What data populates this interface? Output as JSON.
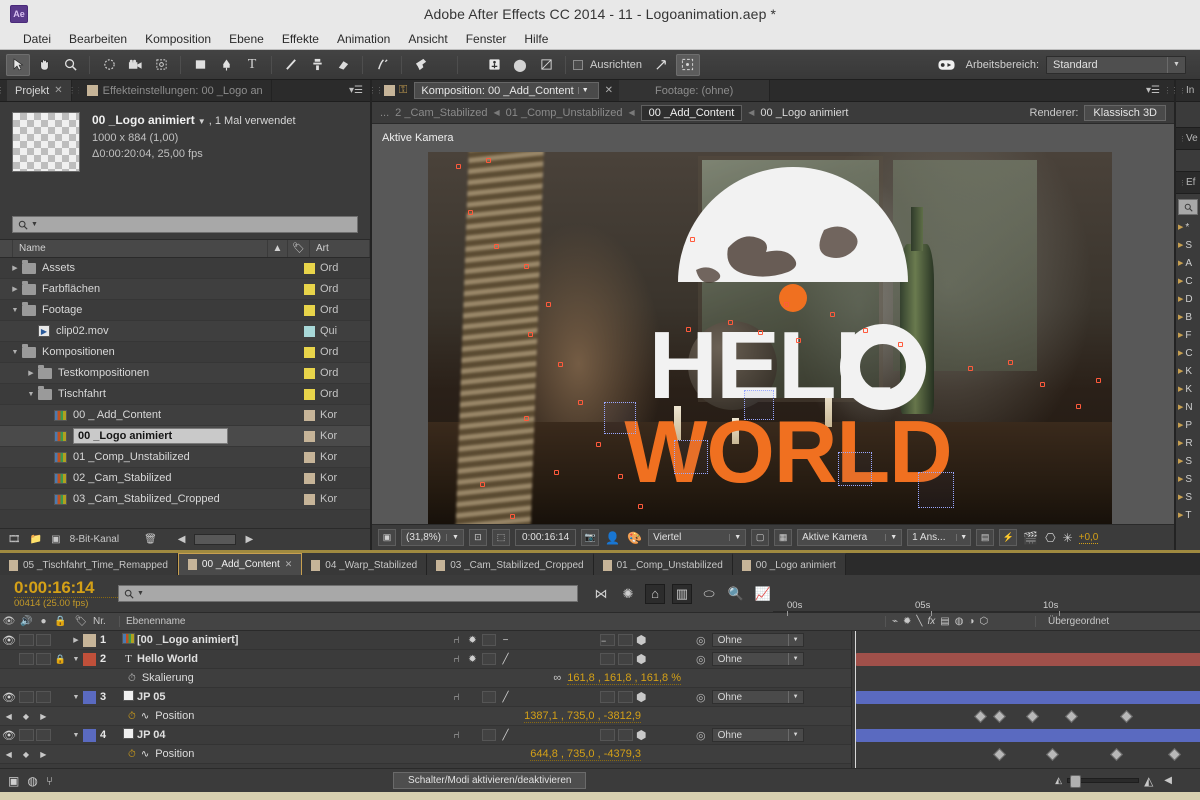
{
  "titlebar": {
    "logo": "Ae",
    "title": "Adobe After Effects CC 2014 - 11 - Logoanimation.aep *"
  },
  "menubar": {
    "items": [
      "Datei",
      "Bearbeiten",
      "Komposition",
      "Ebene",
      "Effekte",
      "Animation",
      "Ansicht",
      "Fenster",
      "Hilfe"
    ]
  },
  "toolbar": {
    "tools": [
      {
        "name": "selection-tool",
        "glyph": "➤"
      },
      {
        "name": "hand-tool",
        "glyph": "✋"
      },
      {
        "name": "zoom-tool",
        "glyph": "🔍"
      },
      {
        "name": "rotation-tool",
        "glyph": "↻"
      },
      {
        "name": "camera-tool",
        "glyph": "🎥"
      },
      {
        "name": "pan-behind-tool",
        "glyph": "✥"
      },
      {
        "name": "shape-tool",
        "glyph": "▢"
      },
      {
        "name": "pen-tool",
        "glyph": "✒"
      },
      {
        "name": "type-tool",
        "glyph": "T"
      },
      {
        "name": "brush-tool",
        "glyph": "/"
      },
      {
        "name": "clone-stamp-tool",
        "glyph": "♟"
      },
      {
        "name": "eraser-tool",
        "glyph": "▱"
      },
      {
        "name": "roto-brush-tool",
        "glyph": "⑂"
      },
      {
        "name": "puppet-pin-tool",
        "glyph": "📌"
      },
      {
        "name": "anchor-tool",
        "glyph": "⚓"
      },
      {
        "name": "mask-tool",
        "glyph": "●"
      },
      {
        "name": "snapping-tool",
        "glyph": "⌗"
      }
    ],
    "align_label": "Ausrichten",
    "workspace_label": "Arbeitsbereich:",
    "workspace_value": "Standard"
  },
  "project_panel": {
    "tabs": [
      {
        "label": "Projekt",
        "active": true,
        "closable": true
      },
      {
        "label": "Effekteinstellungen: 00 _Logo an",
        "active": false,
        "closable": false
      }
    ],
    "selected_item": {
      "name": "00 _Logo animiert",
      "usage": ", 1 Mal verwendet",
      "dimensions": "1000 x 884 (1,00)",
      "duration": "Δ0:00:20:04, 25,00 fps"
    },
    "search_placeholder": "",
    "columns": [
      "Name",
      "Art"
    ],
    "tree": [
      {
        "label": "Assets",
        "type": "folder",
        "indent": 0,
        "twirl": "▶",
        "color": "#e8d44a",
        "art": "Ord"
      },
      {
        "label": "Farbflächen",
        "type": "folder",
        "indent": 0,
        "twirl": "▶",
        "color": "#e8d44a",
        "art": "Ord"
      },
      {
        "label": "Footage",
        "type": "folder",
        "indent": 0,
        "twirl": "▼",
        "color": "#e8d44a",
        "art": "Ord"
      },
      {
        "label": "clip02.mov",
        "type": "movie",
        "indent": 1,
        "twirl": "",
        "color": "#a8d8d8",
        "art": "Qui"
      },
      {
        "label": "Kompositionen",
        "type": "folder",
        "indent": 0,
        "twirl": "▼",
        "color": "#e8d44a",
        "art": "Ord"
      },
      {
        "label": "Testkompositionen",
        "type": "folder",
        "indent": 1,
        "twirl": "▶",
        "color": "#e8d44a",
        "art": "Ord"
      },
      {
        "label": "Tischfahrt",
        "type": "folder",
        "indent": 1,
        "twirl": "▼",
        "color": "#e8d44a",
        "art": "Ord"
      },
      {
        "label": "00 _ Add_Content",
        "type": "comp",
        "indent": 2,
        "twirl": "",
        "color": "#c6b498",
        "art": "Kor"
      },
      {
        "label": "00 _Logo animiert",
        "type": "comp",
        "indent": 2,
        "twirl": "",
        "color": "#c6b498",
        "art": "Kor",
        "selected": true,
        "editing": true
      },
      {
        "label": "01 _Comp_Unstabilized",
        "type": "comp",
        "indent": 2,
        "twirl": "",
        "color": "#c6b498",
        "art": "Kor"
      },
      {
        "label": "02 _Cam_Stabilized",
        "type": "comp",
        "indent": 2,
        "twirl": "",
        "color": "#c6b498",
        "art": "Kor"
      },
      {
        "label": "03 _Cam_Stabilized_Cropped",
        "type": "comp",
        "indent": 2,
        "twirl": "",
        "color": "#c6b498",
        "art": "Kor"
      }
    ],
    "footer": {
      "bit_depth": "8-Bit-Kanal"
    }
  },
  "comp_panel": {
    "tabs": [
      {
        "label": "Komposition: 00 _Add_Content",
        "active": true
      },
      {
        "label": "Footage: (ohne)",
        "active": false
      }
    ],
    "breadcrumb": [
      "...",
      "2 _Cam_Stabilized",
      "01 _Comp_Unstabilized",
      "00 _Add_Content",
      "00 _Logo animiert"
    ],
    "breadcrumb_current_index": 3,
    "renderer_label": "Renderer:",
    "renderer_value": "Klassisch 3D",
    "view_overlay": "Aktive Kamera",
    "footer": {
      "zoom": "(31,8%)",
      "time": "0:00:16:14",
      "resolution": "Viertel",
      "camera": "Aktive Kamera",
      "views": "1 Ans...",
      "exposure": "+0,0"
    }
  },
  "right_dock": {
    "panels": [
      "In",
      "Ve",
      "Ef"
    ],
    "effect_items": [
      "*",
      "S",
      "A",
      "C",
      "D",
      "B",
      "F",
      "C",
      "K",
      "K",
      "N",
      "P",
      "R",
      "S",
      "S",
      "S",
      "T"
    ]
  },
  "timeline": {
    "tabs": [
      {
        "label": "05 _Tischfahrt_Time_Remapped",
        "active": false
      },
      {
        "label": "00 _Add_Content",
        "active": true
      },
      {
        "label": "04 _Warp_Stabilized",
        "active": false
      },
      {
        "label": "03 _Cam_Stabilized_Cropped",
        "active": false
      },
      {
        "label": "01 _Comp_Unstabilized",
        "active": false
      },
      {
        "label": "00 _Logo animiert",
        "active": false
      }
    ],
    "current_time": "0:00:16:14",
    "frame_info": "00414 (25.00 fps)",
    "search_placeholder": "",
    "columns": {
      "number": "Nr.",
      "layer_name": "Ebenenname",
      "parent": "Übergeordnet"
    },
    "ruler_ticks": [
      "00s",
      "05s",
      "10s"
    ],
    "layers": [
      {
        "num": "1",
        "name": "[00 _Logo animiert]",
        "label_color": "#c6b498",
        "icon": "comp-icon",
        "visible": true,
        "locked": false,
        "twirl": "▶",
        "parent": "Ohne",
        "bar_color": "",
        "properties": []
      },
      {
        "num": "2",
        "name": "Hello World",
        "label_color": "#c0503a",
        "icon": "text-icon",
        "visible": false,
        "locked": true,
        "twirl": "▼",
        "parent": "Ohne",
        "bar_color": "#a0504a",
        "properties": [
          {
            "name": "Skalierung",
            "value": "161,8 , 161,8 , 161,8 %",
            "linked": true,
            "keyframes": []
          }
        ]
      },
      {
        "num": "3",
        "name": "JP 05",
        "label_color": "#5a6ac0",
        "icon": "solid-icon",
        "visible": true,
        "locked": false,
        "twirl": "▼",
        "parent": "Ohne",
        "bar_color": "#5a6ac0",
        "properties": [
          {
            "name": "Position",
            "value": "1387,1 , 735,0 , -3812,9",
            "linked": false,
            "keyframes": [
              124,
              143,
              176,
              215,
              270
            ]
          }
        ]
      },
      {
        "num": "4",
        "name": "JP 04",
        "label_color": "#5a6ac0",
        "icon": "solid-icon",
        "visible": true,
        "locked": false,
        "twirl": "▼",
        "parent": "Ohne",
        "bar_color": "#5a6ac0",
        "properties": [
          {
            "name": "Position",
            "value": "644,8 , 735,0 , -4379,3",
            "linked": false,
            "keyframes": [
              143,
              196,
              260,
              318
            ]
          }
        ]
      }
    ],
    "footer": {
      "switches_button": "Schalter/Modi aktivieren/deaktivieren"
    }
  },
  "colors": {
    "accent_orange": "#d4a017",
    "panel_bg": "#3b3b3b",
    "dark_bg": "#2b2b2b",
    "title_bg": "#e8e8e8",
    "layer_red": "#a0504a",
    "layer_blue": "#5a6ac0"
  }
}
